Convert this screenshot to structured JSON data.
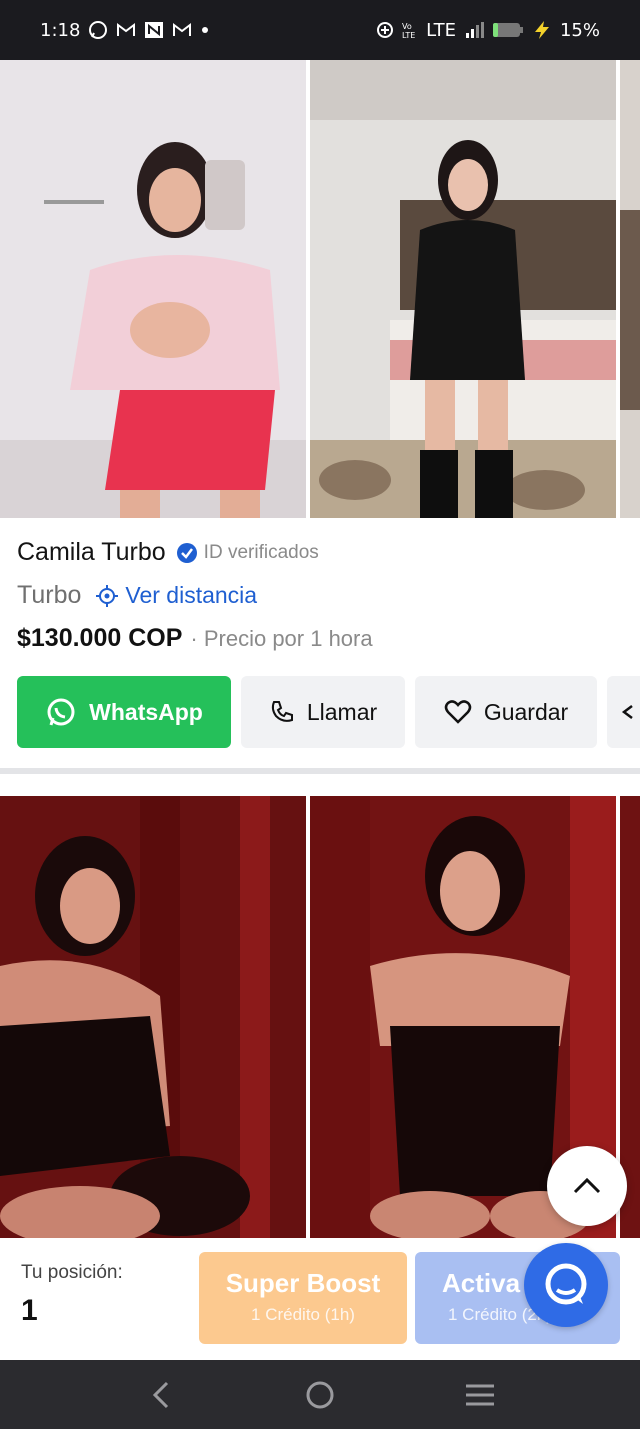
{
  "status_bar": {
    "time": "1:18",
    "network": "LTE",
    "battery": "15%",
    "icons": [
      "whatsapp-icon",
      "gmail-icon",
      "news-icon",
      "gmail-icon",
      "dot-icon",
      "data-saver-icon",
      "volte-icon",
      "signal-icon",
      "battery-icon",
      "charging-icon"
    ]
  },
  "listing": {
    "name": "Camila Turbo",
    "verified_label": "ID verificados",
    "location": "Turbo",
    "distance_link": "Ver distancia",
    "price": "$130.000 COP",
    "price_note": "· Precio por 1 hora",
    "buttons": {
      "whatsapp": "WhatsApp",
      "call": "Llamar",
      "save": "Guardar"
    }
  },
  "bottom_bar": {
    "position_label": "Tu posición:",
    "position_value": "1",
    "super_boost": {
      "title": "Super Boost",
      "subtitle": "1 Crédito (1h)"
    },
    "activate": {
      "title": "Activa",
      "subtitle": "1 Crédito (2h)"
    }
  },
  "colors": {
    "whatsapp_green": "#25c05a",
    "link_blue": "#1f5fd1",
    "boost_orange": "#fcc98f",
    "activate_blue": "#a9bff2",
    "chat_blue": "#2f6be6"
  },
  "nav_icons": [
    "back-icon",
    "home-icon",
    "menu-icon"
  ]
}
